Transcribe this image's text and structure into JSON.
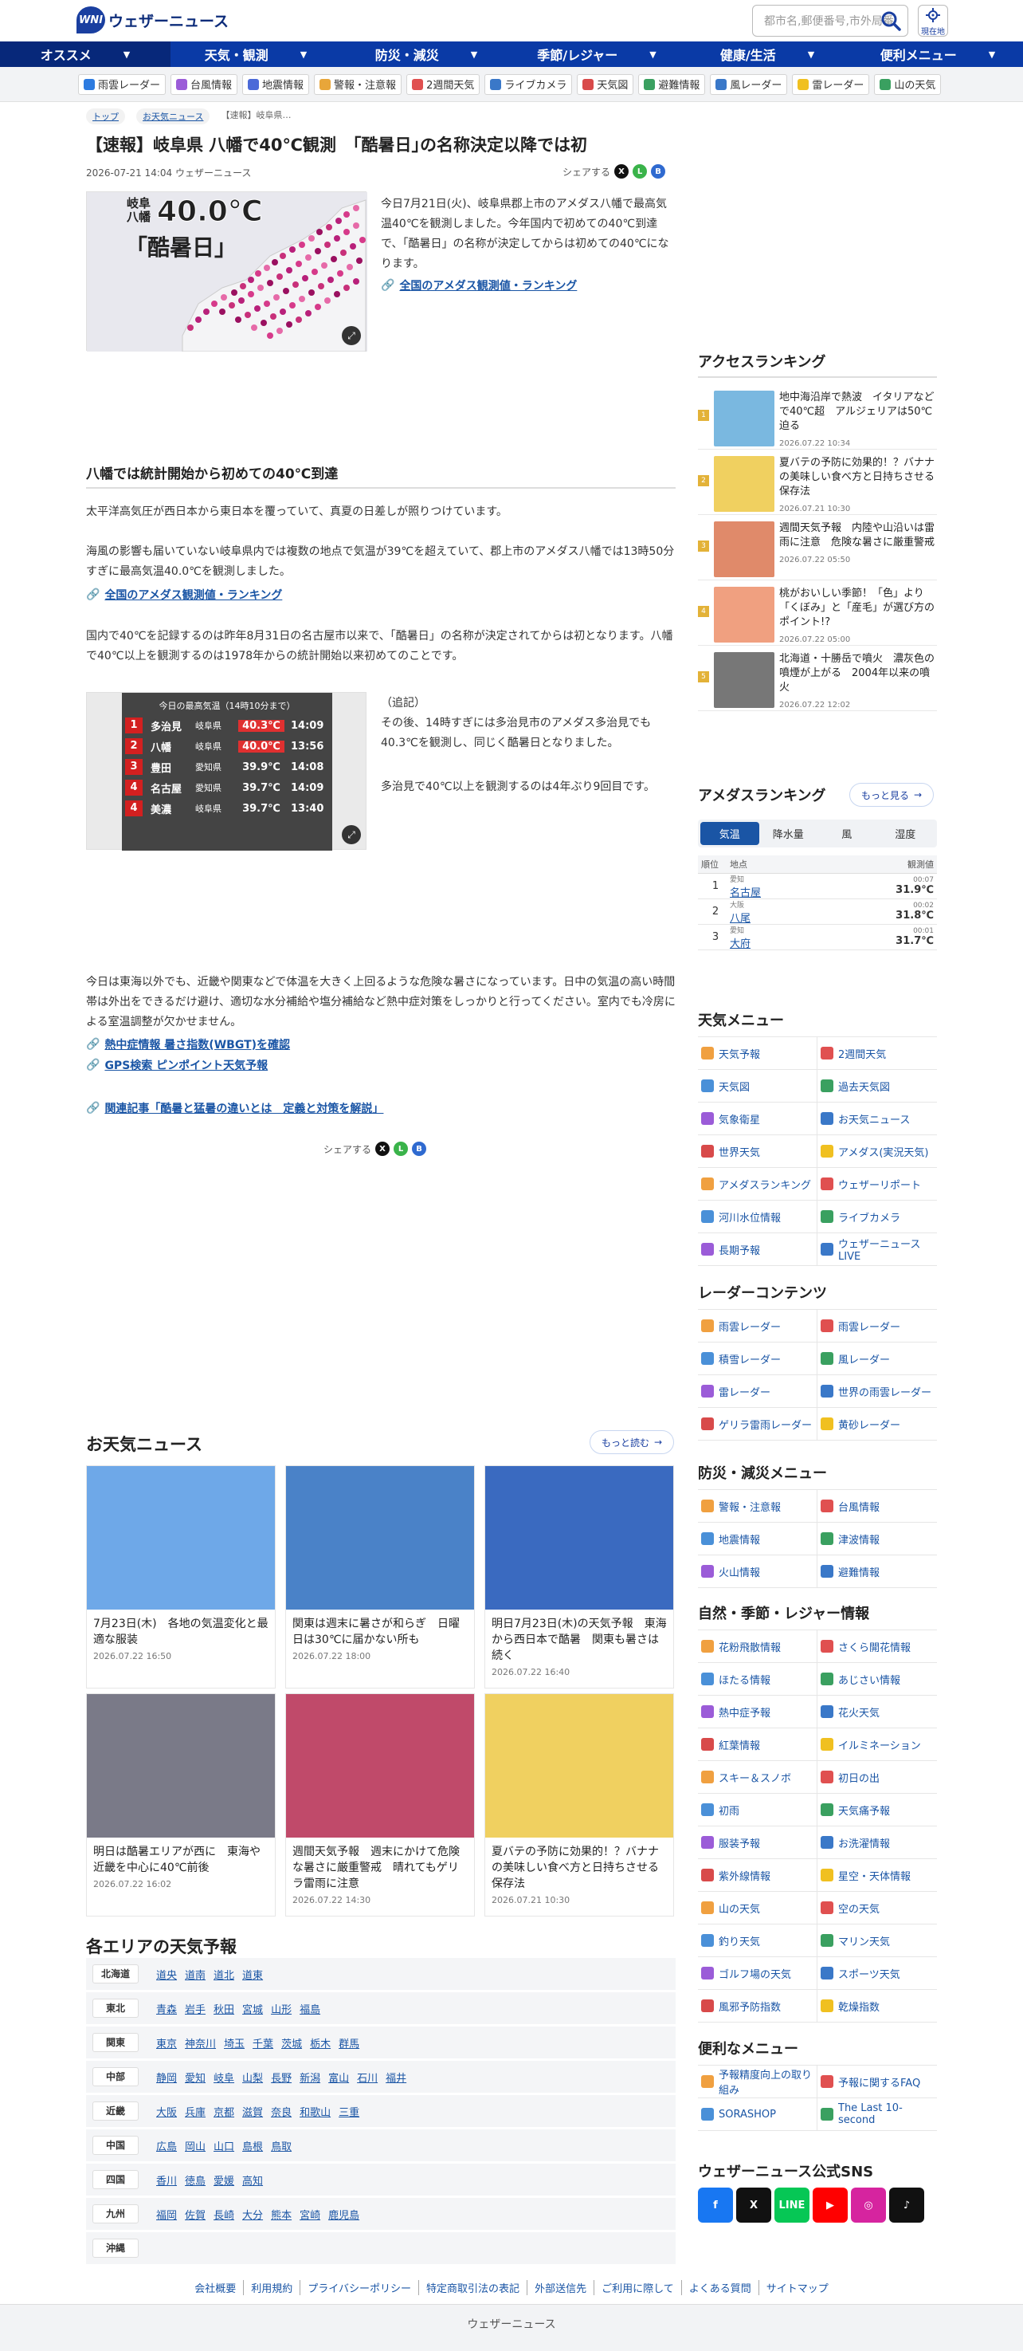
{
  "header": {
    "logo_text": "ウェザーニュース",
    "logo_mark": "WNI",
    "search_placeholder": "都市名,郵便番号,市外局番",
    "location_label": "現在地"
  },
  "nav": [
    {
      "label": "オススメ"
    },
    {
      "label": "天気・観測"
    },
    {
      "label": "防災・減災"
    },
    {
      "label": "季節/レジャー"
    },
    {
      "label": "健康/生活"
    },
    {
      "label": "便利メニュー"
    }
  ],
  "subnav": [
    {
      "label": "雨雲レーダー",
      "color": "#2d7be0"
    },
    {
      "label": "台風情報",
      "color": "#9b5cd8"
    },
    {
      "label": "地震情報",
      "color": "#4c6ad8"
    },
    {
      "label": "警報・注意報",
      "color": "#e8a63a"
    },
    {
      "label": "2週間天気",
      "color": "#e05050"
    },
    {
      "label": "ライブカメラ",
      "color": "#3a78c8"
    },
    {
      "label": "天気図",
      "color": "#d84a4a"
    },
    {
      "label": "避難情報",
      "color": "#3aa060"
    },
    {
      "label": "風レーダー",
      "color": "#3a78c8"
    },
    {
      "label": "雷レーダー",
      "color": "#f0c020"
    },
    {
      "label": "山の天気",
      "color": "#3aa060"
    }
  ],
  "breadcrumb": [
    "トップ",
    "お天気ニュース",
    "【速報】岐阜県…"
  ],
  "article": {
    "title": "【速報】岐阜県 八幡で40℃観測　｢酷暑日｣の名称決定以降では初",
    "date": "2026-07-21 14:04 ウェザーニュース",
    "share_label": "シェアする",
    "fig1_big": "40.0℃",
    "fig1_place": "岐阜\n八幡",
    "fig1_word": "「酷暑日」",
    "intro": "今日7月21日(火)、岐阜県郡上市のアメダス八幡で最高気温40℃を観測しました。今年国内で初めての40℃到達で、「酷暑日」の名称が決定してからは初めての40℃になります。",
    "link_ranking": "全国のアメダス観測値・ランキング",
    "h2": "八幡では統計開始から初めての40℃到達",
    "p1": "太平洋高気圧が西日本から東日本を覆っていて、真夏の日差しが照りつけています。",
    "p2": "海風の影響も届いていない岐阜県内では複数の地点で気温が39℃を超えていて、郡上市のアメダス八幡では13時50分すぎに最高気温40.0℃を観測しました。",
    "link_ranking2": "全国のアメダス観測値・ランキング",
    "p3": "国内で40℃を記録するのは昨年8月31日の名古屋市以来で、「酷暑日」の名称が決定されてからは初となります。八幡で40℃以上を観測するのは1978年からの統計開始以来初めてのことです。",
    "fig2_caption": "今日の最高気温（14時10分まで）",
    "rank_rows": [
      {
        "rank": "1",
        "name": "多治見",
        "pref": "岐阜県",
        "temp": "40.3℃",
        "time": "14:09",
        "hot": true
      },
      {
        "rank": "2",
        "name": "八幡",
        "pref": "岐阜県",
        "temp": "40.0℃",
        "time": "13:56",
        "hot": true
      },
      {
        "rank": "3",
        "name": "豊田",
        "pref": "愛知県",
        "temp": "39.9℃",
        "time": "14:08",
        "hot": false
      },
      {
        "rank": "4",
        "name": "名古屋",
        "pref": "愛知県",
        "temp": "39.7℃",
        "time": "14:09",
        "hot": false
      },
      {
        "rank": "4",
        "name": "美濃",
        "pref": "岐阜県",
        "temp": "39.7℃",
        "time": "13:40",
        "hot": false
      }
    ],
    "addendum_title": "（追記）",
    "addendum": "その後、14時すぎには多治見市のアメダス多治見でも40.3℃を観測し、同じく酷暑日となりました。",
    "addendum2": "多治見で40℃以上を観測するのは4年ぶり9回目です。",
    "p4": "今日は東海以外でも、近畿や関東などで体温を大きく上回るような危険な暑さになっています。日中の気温の高い時間帯は外出をできるだけ避け、適切な水分補給や塩分補給など熱中症対策をしっかりと行ってください。室内でも冷房による室温調整が欠かせません。",
    "link_wbgt": "熱中症情報 暑さ指数(WBGT)を確認",
    "link_gps": "GPS検索 ピンポイント天気予報",
    "link_related": "関連記事「酷暑と猛暑の違いとは　定義と対策を解説」"
  },
  "news": {
    "title": "お天気ニュース",
    "more": "もっと読む",
    "items": [
      {
        "title": "7月23日(木)　各地の気温変化と最適な服装",
        "date": "2026.07.22 16:50"
      },
      {
        "title": "関東は週末に暑さが和らぎ　日曜日は30℃に届かない所も",
        "date": "2026.07.22 18:00"
      },
      {
        "title": "明日7月23日(木)の天気予報　東海から西日本で酷暑　関東も暑さは続く",
        "date": "2026.07.22 16:40"
      },
      {
        "title": "明日は酷暑エリアが西に　東海や近畿を中心に40℃前後",
        "date": "2026.07.22 16:02"
      },
      {
        "title": "週間天気予報　週末にかけて危険な暑さに厳重警戒　晴れてもゲリラ雷雨に注意",
        "date": "2026.07.22 14:30"
      },
      {
        "title": "夏バテの予防に効果的！？バナナの美味しい食べ方と日持ちさせる保存法",
        "date": "2026.07.21 10:30"
      }
    ]
  },
  "areas": {
    "title": "各エリアの天気予報",
    "rows": [
      {
        "label": "北海道",
        "links": [
          "道央",
          "道南",
          "道北",
          "道東"
        ]
      },
      {
        "label": "東北",
        "links": [
          "青森",
          "岩手",
          "秋田",
          "宮城",
          "山形",
          "福島"
        ]
      },
      {
        "label": "関東",
        "links": [
          "東京",
          "神奈川",
          "埼玉",
          "千葉",
          "茨城",
          "栃木",
          "群馬"
        ]
      },
      {
        "label": "中部",
        "links": [
          "静岡",
          "愛知",
          "岐阜",
          "山梨",
          "長野",
          "新潟",
          "富山",
          "石川",
          "福井"
        ]
      },
      {
        "label": "近畿",
        "links": [
          "大阪",
          "兵庫",
          "京都",
          "滋賀",
          "奈良",
          "和歌山",
          "三重"
        ]
      },
      {
        "label": "中国",
        "links": [
          "広島",
          "岡山",
          "山口",
          "島根",
          "鳥取"
        ]
      },
      {
        "label": "四国",
        "links": [
          "香川",
          "徳島",
          "愛媛",
          "高知"
        ]
      },
      {
        "label": "九州",
        "links": [
          "福岡",
          "佐賀",
          "長崎",
          "大分",
          "熊本",
          "宮崎",
          "鹿児島"
        ]
      },
      {
        "label": "沖縄",
        "links": []
      }
    ]
  },
  "access": {
    "title": "アクセスランキング",
    "items": [
      {
        "num": "1",
        "title": "地中海沿岸で熱波　イタリアなどで40℃超　アルジェリアは50℃迫る",
        "date": "2026.07.22 10:34"
      },
      {
        "num": "2",
        "title": "夏バテの予防に効果的！？バナナの美味しい食べ方と日持ちさせる保存法",
        "date": "2026.07.21 10:30"
      },
      {
        "num": "3",
        "title": "週間天気予報　内陸や山沿いは雷雨に注意　危険な暑さに厳重警戒",
        "date": "2026.07.22 05:50"
      },
      {
        "num": "4",
        "title": "桃がおいしい季節！「色」より「くぼみ」と「産毛」が選び方のポイント!?",
        "date": "2026.07.22 05:00"
      },
      {
        "num": "5",
        "title": "北海道・十勝岳で噴火　濃灰色の噴煙が上がる　2004年以来の噴火",
        "date": "2026.07.22 12:02"
      }
    ]
  },
  "amedas": {
    "title": "アメダスランキング",
    "more": "もっと見る",
    "tabs": [
      "気温",
      "降水量",
      "風",
      "湿度"
    ],
    "headers": [
      "順位",
      "地点",
      "観測値"
    ],
    "rows": [
      {
        "rank": "1",
        "pref": "愛知",
        "name": "名古屋",
        "time": "00:07",
        "value": "31.9℃"
      },
      {
        "rank": "2",
        "pref": "大阪",
        "name": "八尾",
        "time": "00:02",
        "value": "31.8℃"
      },
      {
        "rank": "3",
        "pref": "愛知",
        "name": "大府",
        "time": "00:01",
        "value": "31.7℃"
      }
    ]
  },
  "weather_menu": {
    "title": "天気メニュー",
    "items": [
      "天気予報",
      "2週間天気",
      "天気図",
      "過去天気図",
      "気象衛星",
      "お天気ニュース",
      "世界天気",
      "アメダス(実況天気)",
      "アメダスランキング",
      "ウェザーリポート",
      "河川水位情報",
      "ライブカメラ",
      "長期予報",
      "ウェザーニュースLIVE"
    ]
  },
  "radar_menu": {
    "title": "レーダーコンテンツ",
    "items": [
      "雨雲レーダー",
      "雨雲レーダー",
      "積雪レーダー",
      "風レーダー",
      "雷レーダー",
      "世界の雨雲レーダー",
      "ゲリラ雷雨レーダー",
      "黄砂レーダー"
    ]
  },
  "disaster_menu": {
    "title": "防災・減災メニュー",
    "items": [
      "警報・注意報",
      "台風情報",
      "地震情報",
      "津波情報",
      "火山情報",
      "避難情報"
    ]
  },
  "season_menu": {
    "title": "自然・季節・レジャー情報",
    "items": [
      "花粉飛散情報",
      "さくら開花情報",
      "ほたる情報",
      "あじさい情報",
      "熱中症予報",
      "花火天気",
      "紅葉情報",
      "イルミネーション",
      "スキー＆スノボ",
      "初日の出",
      "初雨",
      "天気痛予報",
      "服装予報",
      "お洗濯情報",
      "紫外線情報",
      "星空・天体情報",
      "山の天気",
      "空の天気",
      "釣り天気",
      "マリン天気",
      "ゴルフ場の天気",
      "スポーツ天気",
      "風邪予防指数",
      "乾燥指数"
    ]
  },
  "convenient_menu": {
    "title": "便利なメニュー",
    "items": [
      "予報精度向上の取り組み",
      "予報に関するFAQ",
      "SORASHOP",
      "The Last 10-second"
    ]
  },
  "sns": {
    "title": "ウェザーニュース公式SNS",
    "icons": [
      {
        "name": "facebook",
        "label": "f",
        "color": "#1877f2"
      },
      {
        "name": "x",
        "label": "X",
        "color": "#111111"
      },
      {
        "name": "line",
        "label": "LINE",
        "color": "#06c755"
      },
      {
        "name": "youtube",
        "label": "▶",
        "color": "#ff0000"
      },
      {
        "name": "instagram",
        "label": "◎",
        "color": "#d6249f"
      },
      {
        "name": "tiktok",
        "label": "♪",
        "color": "#111111"
      }
    ]
  },
  "footer": {
    "links": [
      "会社概要",
      "利用規約",
      "プライバシーポリシー",
      "特定商取引法の表記",
      "外部送信先",
      "ご利用に際して",
      "よくある質問",
      "サイトマップ"
    ],
    "brand": "ウェザーニュース"
  },
  "colors": {
    "brand": "#0a3aa6",
    "link": "#1a55a5",
    "hot": "#e03030"
  }
}
